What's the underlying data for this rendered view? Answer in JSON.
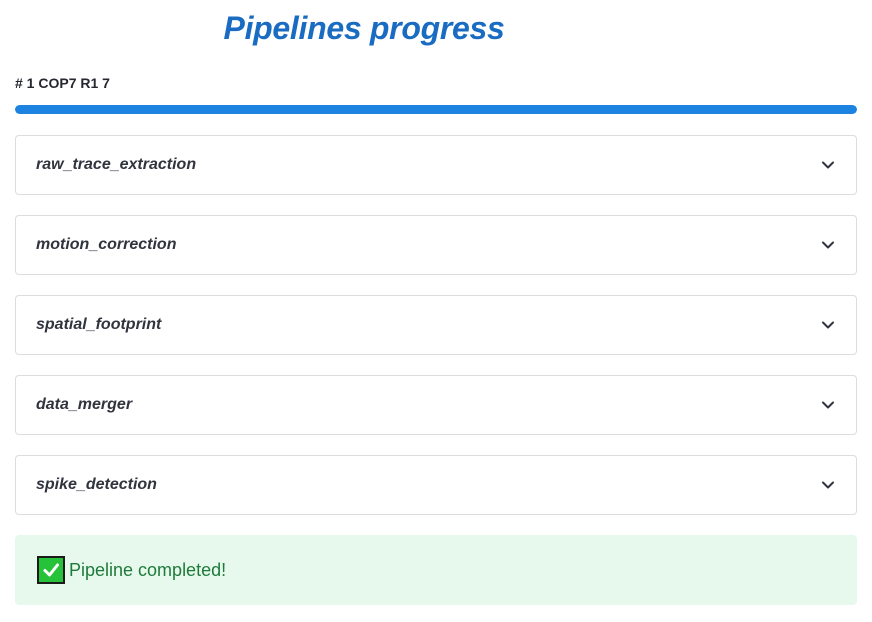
{
  "page": {
    "title": "Pipelines progress"
  },
  "progress": {
    "label": "# 1 COP7 R1 7",
    "percent": 100,
    "color": "#1c83e1"
  },
  "expanders": [
    {
      "label": "raw_trace_extraction",
      "icon": "chevron-down-icon"
    },
    {
      "label": "motion_correction",
      "icon": "chevron-down-icon"
    },
    {
      "label": "spatial_footprint",
      "icon": "chevron-down-icon"
    },
    {
      "label": "data_merger",
      "icon": "chevron-down-icon"
    },
    {
      "label": "spike_detection",
      "icon": "chevron-down-icon"
    }
  ],
  "status": {
    "icon": "check-mark-icon",
    "message": "Pipeline completed!",
    "color": "#1f7a3b",
    "background": "#e6f9ec"
  }
}
